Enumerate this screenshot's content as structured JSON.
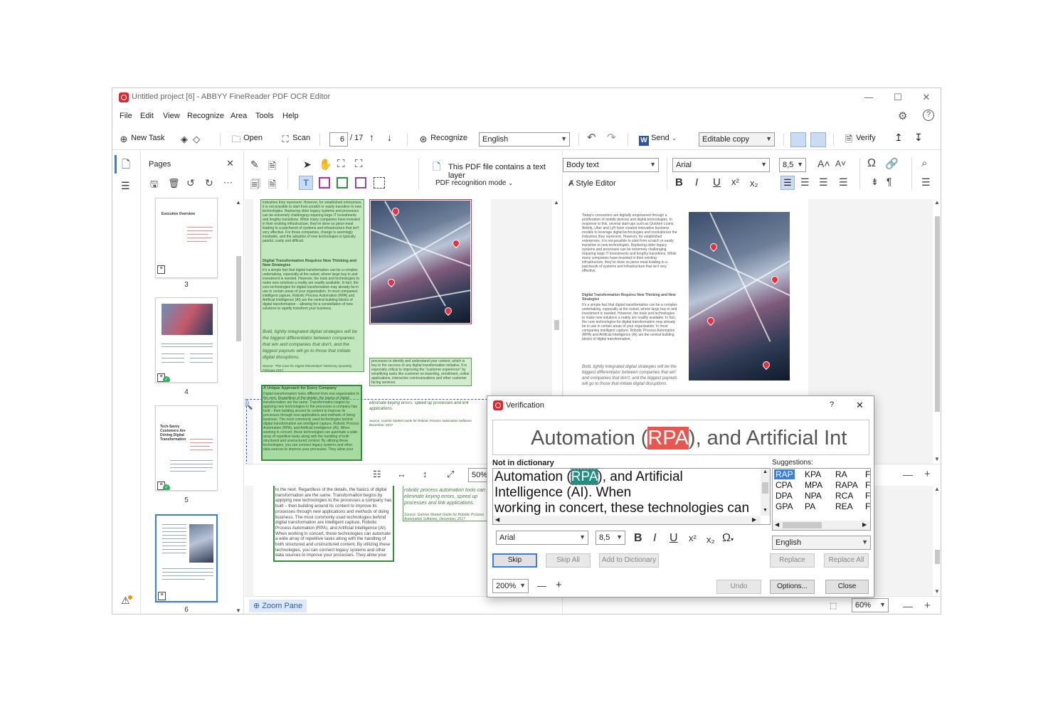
{
  "window": {
    "title": "Untitled project [6] - ABBYY FineReader PDF OCR Editor",
    "minimize": "—",
    "maximize": "☐",
    "close": "✕"
  },
  "menu": [
    "File",
    "Edit",
    "View",
    "Recognize",
    "Area",
    "Tools",
    "Help"
  ],
  "toolbar": {
    "new_task": "New Task",
    "open": "Open",
    "scan": "Scan",
    "page_current": "6",
    "page_total": "/ 17",
    "recognize": "Recognize",
    "language": "English",
    "send": "Send",
    "mode": "Editable copy",
    "verify": "Verify"
  },
  "pages_pane": {
    "title": "Pages",
    "pages": [
      {
        "number": "3",
        "heading": "Executive Overview"
      },
      {
        "number": "4",
        "heading": ""
      },
      {
        "number": "5",
        "heading": "Tech-Savvy Customers Are Driving Digital Transformation"
      },
      {
        "number": "6",
        "heading": ""
      }
    ]
  },
  "image_pane": {
    "text_layer_notice": "This PDF file contains a text layer",
    "recognition_mode": "PDF recognition mode",
    "zoom": "50%",
    "zoom_pane": "Zoom Pane",
    "heading1": "Digital Transformation Requires New Thinking and New Strategies",
    "heading2": "A Unique Approach for Every Company",
    "quote": "Bold, tightly integrated digital strategies will be the biggest differentiator between companies that win and companies that don't, and the biggest payouts will go to those that initiate digital disruptions.",
    "quote_source": "Source: \"The Case for Digital Reinvention\" McKinsey Quarterly, February 2017",
    "side_text": "eliminate keying errors, speed up processes and link applications.",
    "side_source": "Source: Gartner Market Guide for Robotic Process Automation Software, December, 2017"
  },
  "text_pane": {
    "style": "Body text",
    "font": "Arial",
    "size": "8,5",
    "style_editor": "Style Editor",
    "zoom": "60%"
  },
  "verification": {
    "title": "Verification",
    "help": "?",
    "close_x": "✕",
    "image_line_before": "Automation (",
    "image_line_word": "RPA",
    "image_line_after": "), and Artificial Int",
    "not_in_dictionary": "Not in dictionary",
    "context_line1_before": "Automation (",
    "context_line1_word": "RPA",
    "context_line1_after": "), and Artificial",
    "context_line2": "Intelligence (AI). When",
    "context_line3": "working in concert, these technologies can",
    "suggestions_label": "Suggestions:",
    "suggestions": [
      [
        "RAP",
        "KPA",
        "RA",
        "F"
      ],
      [
        "CPA",
        "MPA",
        "RAPA",
        "F"
      ],
      [
        "DPA",
        "NPA",
        "RCA",
        "F"
      ],
      [
        "GPA",
        "PA",
        "REA",
        "F"
      ]
    ],
    "font": "Arial",
    "size": "8,5",
    "language": "English",
    "skip": "Skip",
    "skip_all": "Skip All",
    "add_to_dictionary": "Add to Dictionary",
    "replace": "Replace",
    "replace_all": "Replace All",
    "zoom": "200%",
    "undo": "Undo",
    "options": "Options...",
    "close": "Close"
  },
  "colors": {
    "accent": "#3b7dd8",
    "error_highlight": "#e9564f",
    "context_highlight": "#1f8f83",
    "green_area": "#78c86e",
    "logo": "#e4252c"
  }
}
